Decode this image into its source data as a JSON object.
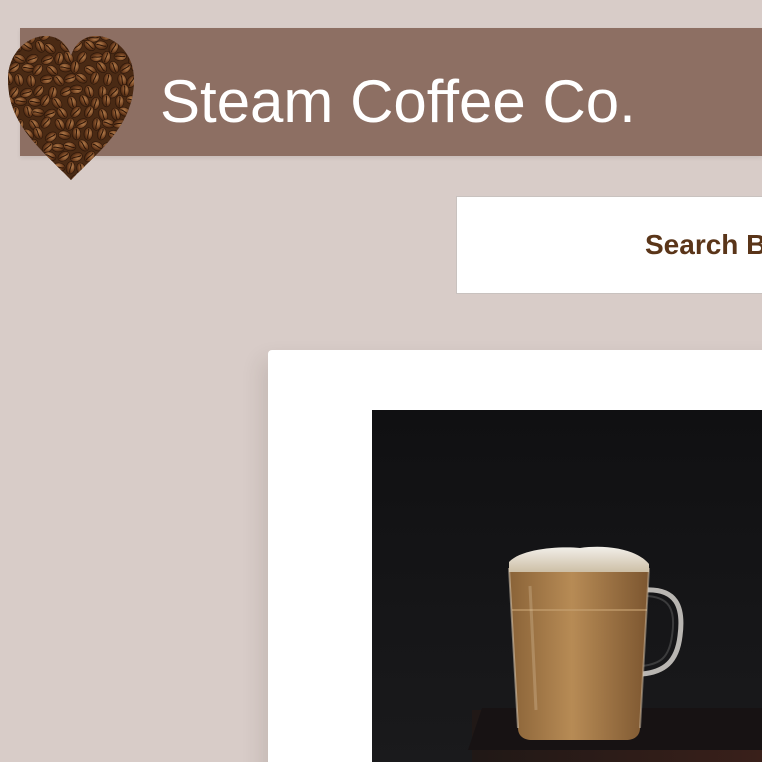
{
  "header": {
    "title": "Steam Coffee Co.",
    "logo_icon": "coffee-bean-heart-icon",
    "background_color": "#8d6f63",
    "title_color": "#ffffff"
  },
  "search": {
    "label": "Search B",
    "label_color": "#5a3519"
  },
  "main": {
    "product_image_icon": "latte-glass-mug-image"
  },
  "colors": {
    "page_background": "#d8ccc8",
    "card_background": "#ffffff"
  }
}
